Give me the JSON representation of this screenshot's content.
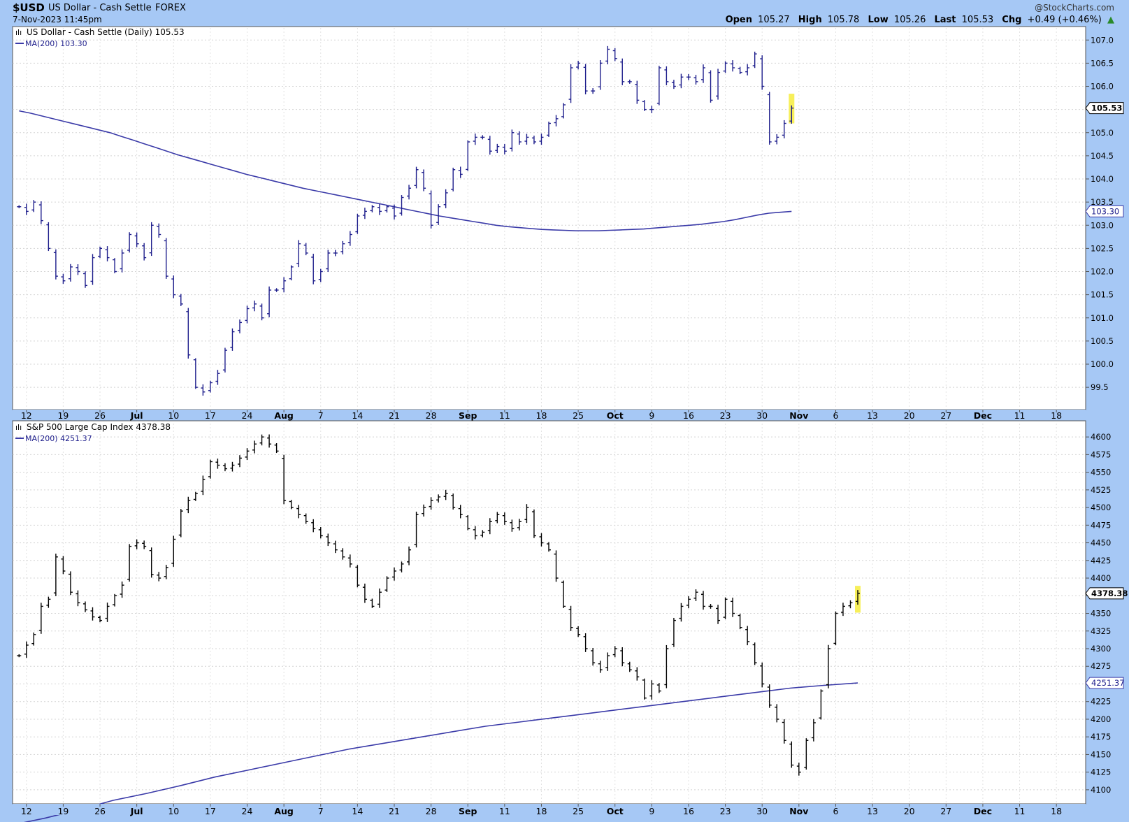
{
  "header": {
    "symbol": "$USD",
    "name": "US Dollar - Cash Settle",
    "exchange": "FOREX",
    "datetime": "7-Nov-2023 11:45pm",
    "brand": "@StockCharts.com",
    "quote": [
      {
        "label": "Open",
        "value": "105.27"
      },
      {
        "label": "High",
        "value": "105.78"
      },
      {
        "label": "Low",
        "value": "105.26"
      },
      {
        "label": "Last",
        "value": "105.53"
      },
      {
        "label": "Chg",
        "value": "+0.49 (+0.46%)"
      }
    ],
    "change_arrow": "▲"
  },
  "colors": {
    "background": "#a6c8f5",
    "panel": "#ffffff",
    "usd_bars": "#1e1e8c",
    "spx_bars": "#000000",
    "ma_line": "#3a3aa8",
    "highlight": "#f7ef5a",
    "grid": "#d4d4d4"
  },
  "chart_data": [
    {
      "type": "ohlc",
      "title": "US Dollar - Cash Settle (Daily) 105.53",
      "ma_label": "MA(200) 103.30",
      "last_value": "105.53",
      "ma_value": "103.30",
      "ylim": [
        99.2,
        107.2
      ],
      "yticks": [
        "99.5",
        "100.0",
        "100.5",
        "101.0",
        "101.5",
        "102.0",
        "102.5",
        "103.0",
        "103.5",
        "104.0",
        "104.5",
        "105.0",
        "105.5",
        "106.0",
        "106.5",
        "107.0"
      ],
      "closes": [
        103.4,
        103.3,
        103.5,
        103.1,
        102.5,
        101.9,
        101.8,
        102.1,
        102.0,
        101.7,
        102.3,
        102.5,
        102.3,
        102.0,
        102.4,
        102.8,
        102.6,
        102.3,
        103.0,
        102.8,
        101.9,
        101.5,
        101.3,
        100.2,
        99.5,
        99.4,
        99.6,
        99.8,
        100.3,
        100.7,
        100.9,
        101.2,
        101.3,
        101.0,
        101.6,
        101.6,
        101.8,
        102.1,
        102.6,
        102.4,
        101.8,
        102.0,
        102.4,
        102.4,
        102.6,
        102.8,
        103.2,
        103.3,
        103.4,
        103.3,
        103.4,
        103.2,
        103.6,
        103.8,
        104.2,
        103.8,
        103.0,
        103.4,
        103.7,
        104.2,
        104.1,
        104.8,
        104.9,
        104.9,
        104.6,
        104.7,
        104.6,
        105.0,
        104.8,
        104.9,
        104.8,
        104.9,
        105.2,
        105.3,
        105.6,
        106.4,
        106.5,
        105.9,
        105.9,
        106.5,
        106.8,
        106.6,
        106.1,
        106.1,
        105.7,
        105.5,
        105.5,
        106.4,
        106.1,
        106.0,
        106.2,
        106.2,
        106.1,
        106.4,
        105.7,
        106.3,
        106.5,
        106.4,
        106.3,
        106.4,
        106.7,
        106.0,
        104.8,
        104.9,
        105.2,
        105.53
      ],
      "ma": [
        105.47,
        105.42,
        105.36,
        105.3,
        105.24,
        105.18,
        105.12,
        105.06,
        105.0,
        104.92,
        104.84,
        104.76,
        104.68,
        104.6,
        104.52,
        104.45,
        104.38,
        104.31,
        104.24,
        104.17,
        104.1,
        104.04,
        103.98,
        103.92,
        103.86,
        103.8,
        103.75,
        103.7,
        103.65,
        103.6,
        103.55,
        103.5,
        103.45,
        103.4,
        103.35,
        103.3,
        103.25,
        103.2,
        103.16,
        103.12,
        103.08,
        103.04,
        103.0,
        102.97,
        102.95,
        102.93,
        102.91,
        102.9,
        102.89,
        102.88,
        102.88,
        102.88,
        102.89,
        102.9,
        102.91,
        102.92,
        102.94,
        102.96,
        102.98,
        103.0,
        103.02,
        103.05,
        103.08,
        103.12,
        103.17,
        103.22,
        103.26,
        103.28,
        103.3
      ],
      "last_highlight": {
        "high": 105.78,
        "low": 105.26
      }
    },
    {
      "type": "ohlc",
      "title": "S&P 500 Large Cap Index 4378.38",
      "ma_label": "MA(200) 4251.37",
      "last_value": "4378.38",
      "ma_value": "4251.37",
      "ylim": [
        4090,
        4615
      ],
      "yticks": [
        "4100",
        "4125",
        "4150",
        "4175",
        "4200",
        "4225",
        "4250",
        "4275",
        "4300",
        "4325",
        "4350",
        "4375",
        "4400",
        "4425",
        "4450",
        "4475",
        "4500",
        "4525",
        "4550",
        "4575",
        "4600"
      ],
      "closes": [
        4290,
        4305,
        4320,
        4360,
        4370,
        4430,
        4410,
        4380,
        4365,
        4355,
        4345,
        4340,
        4360,
        4375,
        4390,
        4445,
        4450,
        4445,
        4405,
        4400,
        4415,
        4455,
        4495,
        4510,
        4520,
        4540,
        4565,
        4560,
        4555,
        4560,
        4570,
        4580,
        4590,
        4600,
        4590,
        4580,
        4510,
        4500,
        4490,
        4480,
        4470,
        4460,
        4450,
        4440,
        4430,
        4420,
        4390,
        4370,
        4360,
        4380,
        4400,
        4410,
        4420,
        4440,
        4490,
        4500,
        4510,
        4515,
        4520,
        4500,
        4490,
        4470,
        4460,
        4465,
        4480,
        4490,
        4480,
        4470,
        4480,
        4500,
        4460,
        4450,
        4440,
        4400,
        4360,
        4330,
        4320,
        4300,
        4280,
        4270,
        4290,
        4300,
        4280,
        4270,
        4260,
        4230,
        4250,
        4240,
        4300,
        4340,
        4360,
        4370,
        4380,
        4360,
        4360,
        4340,
        4370,
        4350,
        4330,
        4310,
        4280,
        4250,
        4220,
        4200,
        4170,
        4135,
        4125,
        4170,
        4195,
        4240,
        4300,
        4350,
        4360,
        4365,
        4378.38
      ],
      "ma": [
        4040,
        4050,
        4060,
        4072,
        4085,
        4095,
        4106,
        4118,
        4128,
        4138,
        4148,
        4158,
        4166,
        4174,
        4182,
        4190,
        4196,
        4202,
        4208,
        4214,
        4220,
        4226,
        4232,
        4238,
        4244,
        4248,
        4251.37
      ],
      "last_highlight": {
        "high": 4385,
        "low": 4355
      }
    }
  ],
  "xaxis": {
    "labels": [
      "12",
      "19",
      "26",
      "Jul",
      "10",
      "17",
      "24",
      "Aug",
      "7",
      "14",
      "21",
      "28",
      "Sep",
      "11",
      "18",
      "25",
      "Oct",
      "9",
      "16",
      "23",
      "30",
      "Nov",
      "6",
      "13",
      "20",
      "27",
      "Dec",
      "11",
      "18"
    ],
    "bold": [
      "Jul",
      "Aug",
      "Sep",
      "Oct",
      "Nov",
      "Dec"
    ]
  }
}
